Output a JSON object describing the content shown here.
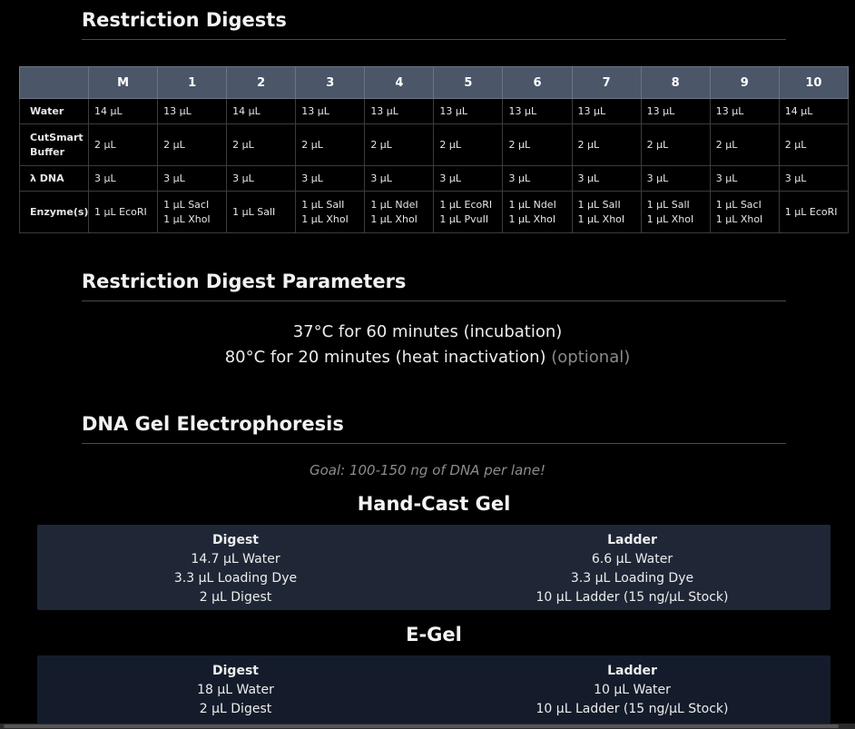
{
  "sections": {
    "digests_title": "Restriction Digests",
    "params_title": "Restriction Digest Parameters",
    "gel_title": "DNA Gel Electrophoresis"
  },
  "digest_table": {
    "columns": [
      "",
      "M",
      "1",
      "2",
      "3",
      "4",
      "5",
      "6",
      "7",
      "8",
      "9",
      "10"
    ],
    "rows": [
      {
        "label": "Water",
        "cells": [
          "14 µL",
          "13 µL",
          "14 µL",
          "13 µL",
          "13 µL",
          "13 µL",
          "13 µL",
          "13 µL",
          "13 µL",
          "13 µL",
          "14 µL"
        ]
      },
      {
        "label": "CutSmart Buffer",
        "cells": [
          "2 µL",
          "2 µL",
          "2 µL",
          "2 µL",
          "2 µL",
          "2 µL",
          "2 µL",
          "2 µL",
          "2 µL",
          "2 µL",
          "2 µL"
        ]
      },
      {
        "label": "λ DNA",
        "cells": [
          "3 µL",
          "3 µL",
          "3 µL",
          "3 µL",
          "3 µL",
          "3 µL",
          "3 µL",
          "3 µL",
          "3 µL",
          "3 µL",
          "3 µL"
        ]
      },
      {
        "label": "Enzyme(s)",
        "cells": [
          [
            "1 µL EcoRI"
          ],
          [
            "1 µL SacI",
            "1 µL XhoI"
          ],
          [
            "1 µL SalI"
          ],
          [
            "1 µL SalI",
            "1 µL XhoI"
          ],
          [
            "1 µL NdeI",
            "1 µL XhoI"
          ],
          [
            "1 µL EcoRI",
            "1 µL PvuII"
          ],
          [
            "1 µL NdeI",
            "1 µL XhoI"
          ],
          [
            "1 µL SalI",
            "1 µL XhoI"
          ],
          [
            "1 µL SalI",
            "1 µL XhoI"
          ],
          [
            "1 µL SacI",
            "1 µL XhoI"
          ],
          [
            "1 µL EcoRI"
          ]
        ]
      }
    ]
  },
  "params": {
    "line1": "37°C for 60 minutes (incubation)",
    "line2": "80°C for 20 minutes (heat inactivation)",
    "optional": "(optional)"
  },
  "goal": "Goal: 100-150 ng of DNA per lane!",
  "hand_cast": {
    "title": "Hand-Cast Gel",
    "digest": {
      "head": "Digest",
      "lines": [
        "14.7 µL Water",
        "3.3 µL Loading Dye",
        "2 µL Digest"
      ]
    },
    "ladder": {
      "head": "Ladder",
      "lines": [
        "6.6 µL Water",
        "3.3 µL Loading Dye",
        "10 µL Ladder (15 ng/µL Stock)"
      ]
    }
  },
  "egel": {
    "title": "E-Gel",
    "digest": {
      "head": "Digest",
      "lines": [
        "18 µL Water",
        "2 µL Digest"
      ]
    },
    "ladder": {
      "head": "Ladder",
      "lines": [
        "10 µL Water",
        "10 µL Ladder (15 ng/µL Stock)"
      ]
    }
  }
}
